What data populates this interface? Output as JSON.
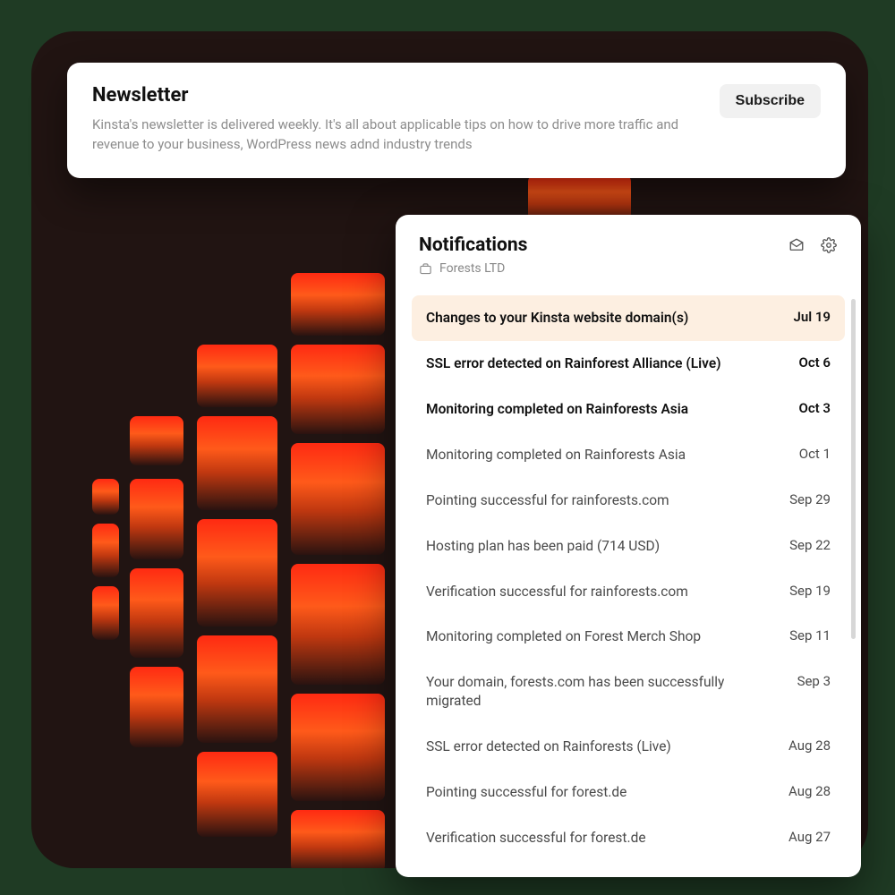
{
  "newsletter": {
    "title": "Newsletter",
    "description": "Kinsta's newsletter is delivered weekly. It's all about applicable tips on how to drive more traffic and revenue to your business, WordPress news adnd industry trends",
    "subscribe_label": "Subscribe"
  },
  "notifications": {
    "title": "Notifications",
    "org": "Forests LTD",
    "items": [
      {
        "title": "Changes to your Kinsta website domain(s)",
        "date": "Jul 19",
        "unread": true,
        "highlight": true
      },
      {
        "title": "SSL error detected on Rainforest Alliance (Live)",
        "date": "Oct 6",
        "unread": true,
        "highlight": false
      },
      {
        "title": "Monitoring completed on Rainforests Asia",
        "date": "Oct 3",
        "unread": true,
        "highlight": false
      },
      {
        "title": "Monitoring completed on Rainforests Asia",
        "date": "Oct 1",
        "unread": false,
        "highlight": false
      },
      {
        "title": "Pointing successful for rainforests.com",
        "date": "Sep 29",
        "unread": false,
        "highlight": false
      },
      {
        "title": "Hosting plan has been paid (714 USD)",
        "date": "Sep 22",
        "unread": false,
        "highlight": false
      },
      {
        "title": "Verification successful for rainforests.com",
        "date": "Sep 19",
        "unread": false,
        "highlight": false
      },
      {
        "title": "Monitoring completed on Forest Merch Shop",
        "date": "Sep 11",
        "unread": false,
        "highlight": false
      },
      {
        "title": "Your domain, forests.com has been successfully migrated",
        "date": "Sep 3",
        "unread": false,
        "highlight": false
      },
      {
        "title": "SSL error detected on Rainforests (Live)",
        "date": "Aug 28",
        "unread": false,
        "highlight": false
      },
      {
        "title": "Pointing successful for forest.de",
        "date": "Aug 28",
        "unread": false,
        "highlight": false
      },
      {
        "title": "Verification successful for forest.de",
        "date": "Aug 27",
        "unread": false,
        "highlight": false
      }
    ]
  }
}
